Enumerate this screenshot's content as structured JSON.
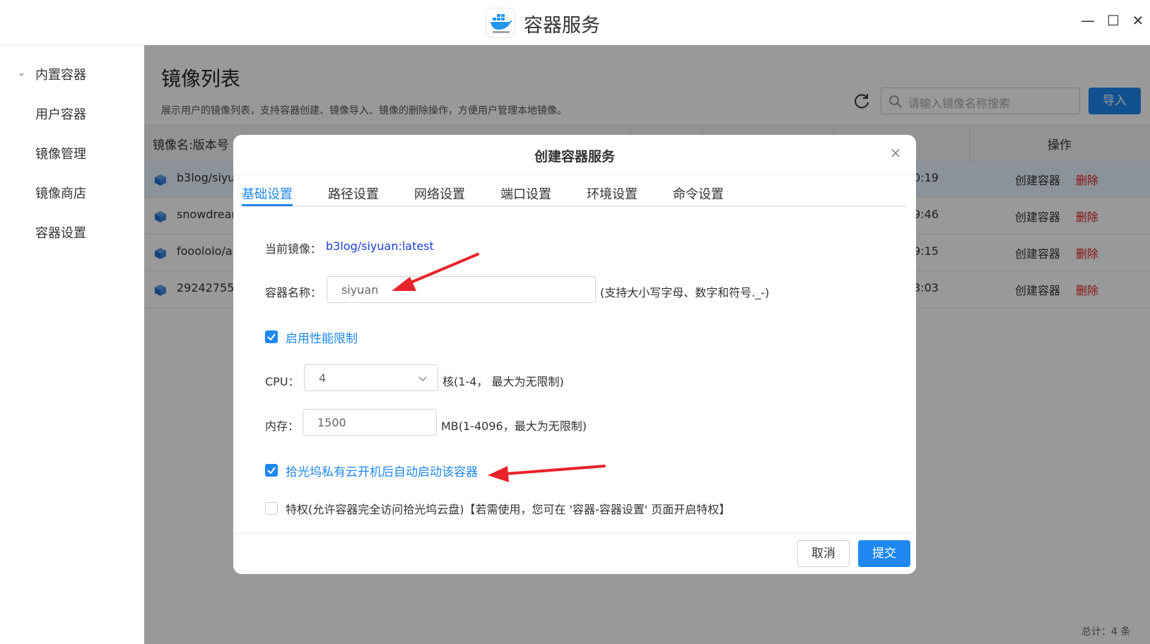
{
  "window": {
    "title": "容器服务"
  },
  "sidebar": {
    "items": [
      {
        "label": "内置容器"
      },
      {
        "label": "用户容器"
      },
      {
        "label": "镜像管理"
      },
      {
        "label": "镜像商店"
      },
      {
        "label": "容器设置"
      }
    ]
  },
  "page": {
    "title": "镜像列表",
    "description": "展示用户的镜像列表，支持容器创建、镜像导入、镜像的删除操作，方便用户管理本地镜像。",
    "search_placeholder": "请输入镜像名称搜索",
    "import_label": "导入"
  },
  "table": {
    "headers": {
      "name": "镜像名:版本号",
      "actions": "操作"
    },
    "rows": [
      {
        "name": "b3log/siyua",
        "time": "0:19",
        "create": "创建容器",
        "delete": "删除"
      },
      {
        "name": "snowdrean",
        "time": "9:46",
        "create": "创建容器",
        "delete": "删除"
      },
      {
        "name": "fooololo/aip",
        "time": "9:15",
        "create": "创建容器",
        "delete": "删除"
      },
      {
        "name": "292427558",
        "time": "3:03",
        "create": "创建容器",
        "delete": "删除"
      }
    ],
    "total": "总计：4 条"
  },
  "modal": {
    "title": "创建容器服务",
    "tabs": [
      "基础设置",
      "路径设置",
      "网络设置",
      "端口设置",
      "环境设置",
      "命令设置"
    ],
    "current_image_label": "当前镜像：",
    "current_image_value": "b3log/siyuan:latest",
    "name_label": "容器名称：",
    "name_value": "siyuan",
    "name_hint": "(支持大小写字母、数字和符号._-)",
    "perf_limit_label": "启用性能限制",
    "cpu_label": "CPU：",
    "cpu_value": "4",
    "cpu_hint": "核(1-4， 最大为无限制)",
    "mem_label": "内存：",
    "mem_value": "1500",
    "mem_hint": "MB(1-4096，最大为无限制)",
    "autostart_label": "拾光坞私有云开机后自动启动该容器",
    "privileged_label": "特权(允许容器完全访问拾光坞云盘)【若需使用，您可在 '容器-容器设置' 页面开启特权】",
    "cancel_label": "取消",
    "submit_label": "提交"
  },
  "colors": {
    "accent": "#1e88f0",
    "danger": "#e02020",
    "annotation": "#e8232a"
  }
}
